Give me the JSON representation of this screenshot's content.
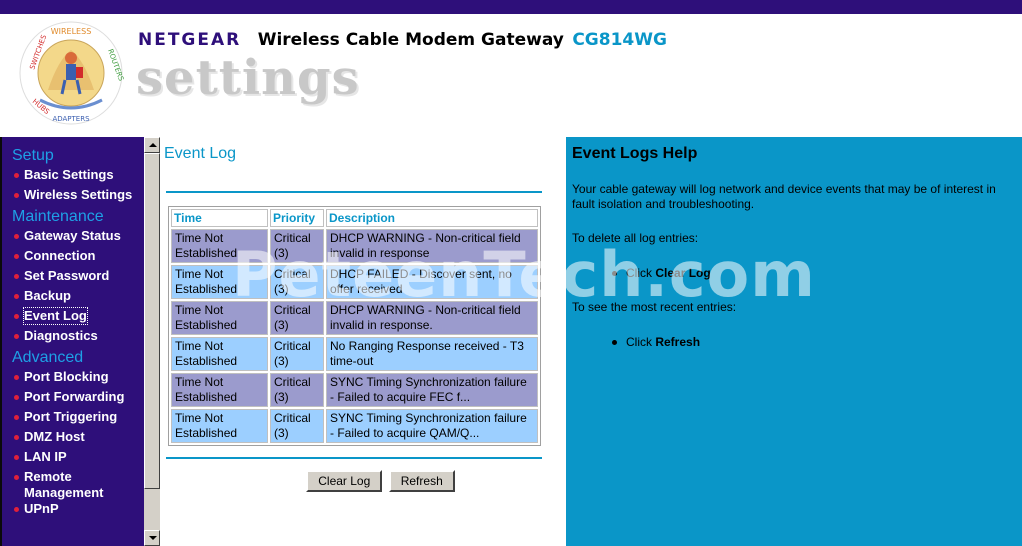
{
  "header": {
    "brand": "NETGEAR",
    "product": "Wireless Cable Modem Gateway",
    "model": "CG814WG",
    "settings_word": "settings",
    "logo_ring_text": "SWITCHES | WIRELESS | ROUTERS | ADAPTERS | HUBS"
  },
  "nav": {
    "sections": [
      {
        "title": "Setup",
        "items": [
          "Basic Settings",
          "Wireless Settings"
        ]
      },
      {
        "title": "Maintenance",
        "items": [
          "Gateway Status",
          "Connection",
          "Set Password",
          "Backup",
          "Event Log",
          "Diagnostics"
        ]
      },
      {
        "title": "Advanced",
        "items": [
          "Port Blocking",
          "Port Forwarding",
          "Port Triggering",
          "DMZ Host",
          "LAN IP",
          "Remote Management",
          "UPnP"
        ]
      }
    ],
    "active": "Event Log"
  },
  "main": {
    "title": "Event Log",
    "columns": [
      "Time",
      "Priority",
      "Description"
    ],
    "rows": [
      {
        "time": "Time Not Established",
        "priority": "Critical (3)",
        "description": "DHCP WARNING - Non-critical field invalid in response"
      },
      {
        "time": "Time Not Established",
        "priority": "Critical (3)",
        "description": "DHCP FAILED - Discover sent, no offer received"
      },
      {
        "time": "Time Not Established",
        "priority": "Critical (3)",
        "description": "DHCP WARNING - Non-critical field invalid in response."
      },
      {
        "time": "Time Not Established",
        "priority": "Critical (3)",
        "description": "No Ranging Response received - T3 time-out"
      },
      {
        "time": "Time Not Established",
        "priority": "Critical (3)",
        "description": "SYNC Timing Synchronization failure - Failed to acquire FEC f..."
      },
      {
        "time": "Time Not Established",
        "priority": "Critical (3)",
        "description": "SYNC Timing Synchronization failure - Failed to acquire QAM/Q..."
      }
    ],
    "clear_log_label": "Clear Log",
    "refresh_label": "Refresh"
  },
  "help": {
    "title": "Event Logs Help",
    "p1": "Your cable gateway will log network and device events that may be of interest in fault isolation and troubleshooting.",
    "p2": "To delete all log entries:",
    "li1_prefix": "Click ",
    "li1_bold": "Clear Log",
    "p3": "To see the most recent entries:",
    "li2_prefix": "Click ",
    "li2_bold": "Refresh"
  },
  "watermark": "PeteenTech.com",
  "colors": {
    "topbar": "#2e0f7a",
    "nav_bg": "#2e0f7a",
    "accent": "#0a96c8",
    "row_odd": "#9b9bcd",
    "row_even": "#9ccfff",
    "bullet": "#e0203a"
  }
}
